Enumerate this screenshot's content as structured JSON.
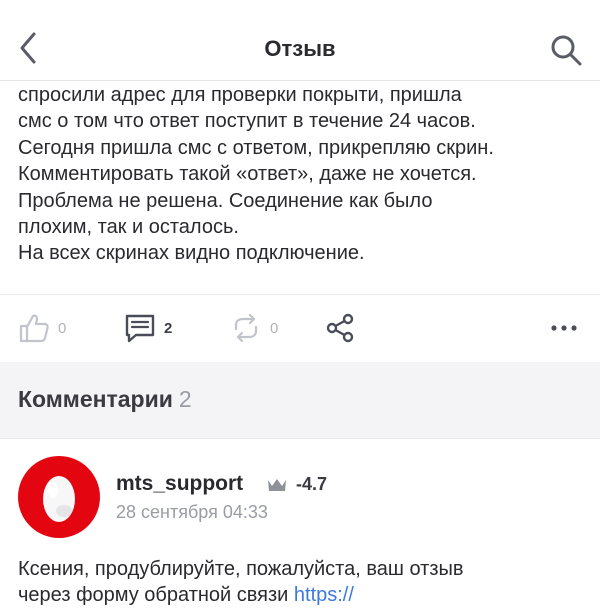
{
  "header": {
    "title": "Отзыв",
    "back_icon": "chevron-left-icon",
    "search_icon": "search-icon"
  },
  "review": {
    "lines": [
      "спросили адрес для проверки покрыти, пришла",
      "смс о том что ответ поступит в течение 24 часов.",
      "Сегодня пришла смс с ответом, прикрепляю скрин.",
      "Комментировать такой «ответ», даже не хочется.",
      "Проблема не решена. Соединение как было",
      "плохим, так и осталось.",
      "На всех скринах видно подключение."
    ]
  },
  "actions": {
    "likes": "0",
    "comments": "2",
    "reposts": "0",
    "icons": [
      "thumbs-up-icon",
      "comment-icon",
      "repost-icon",
      "share-icon",
      "more-icon"
    ]
  },
  "comments_section": {
    "title": "Комментарии",
    "count": "2"
  },
  "comment": {
    "author": "mts_support",
    "rating": "-4.7",
    "date": "28 сентября 04:33",
    "text_line1": "Ксения, продублируйте, пожалуйста, ваш отзыв",
    "text_line2": "через форму обратной связи ",
    "link_text": "https://"
  },
  "colors": {
    "accent": "#3d78e0",
    "avatar_red": "#e30611",
    "muted": "#9a9ca4",
    "icon": "#4a4d57"
  }
}
